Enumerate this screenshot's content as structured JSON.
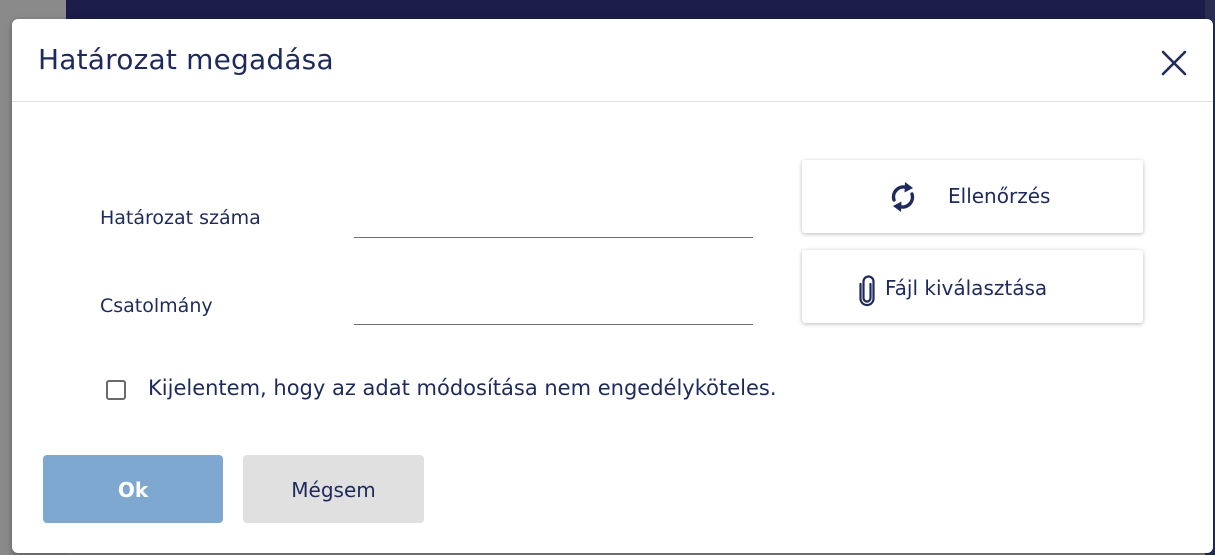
{
  "dialog": {
    "title": "Határozat megadása",
    "close_icon": "close-icon"
  },
  "form": {
    "decision_number_label": "Határozat száma",
    "decision_number_value": "",
    "attachment_label": "Csatolmány",
    "attachment_value": ""
  },
  "actions": {
    "check_label": "Ellenőrzés",
    "check_icon": "refresh-icon",
    "file_select_label": "Fájl kiválasztása",
    "file_select_icon": "paperclip-icon"
  },
  "declaration": {
    "label": "Kijelentem, hogy az adat módosítása nem engedélyköteles.",
    "checked": false
  },
  "footer": {
    "ok_label": "Ok",
    "cancel_label": "Mégsem"
  },
  "colors": {
    "text_primary": "#1f2a5c",
    "ok_button_bg": "#7ea8d0",
    "cancel_button_bg": "#e0e0e0",
    "backdrop_dark": "#1b1d48"
  }
}
